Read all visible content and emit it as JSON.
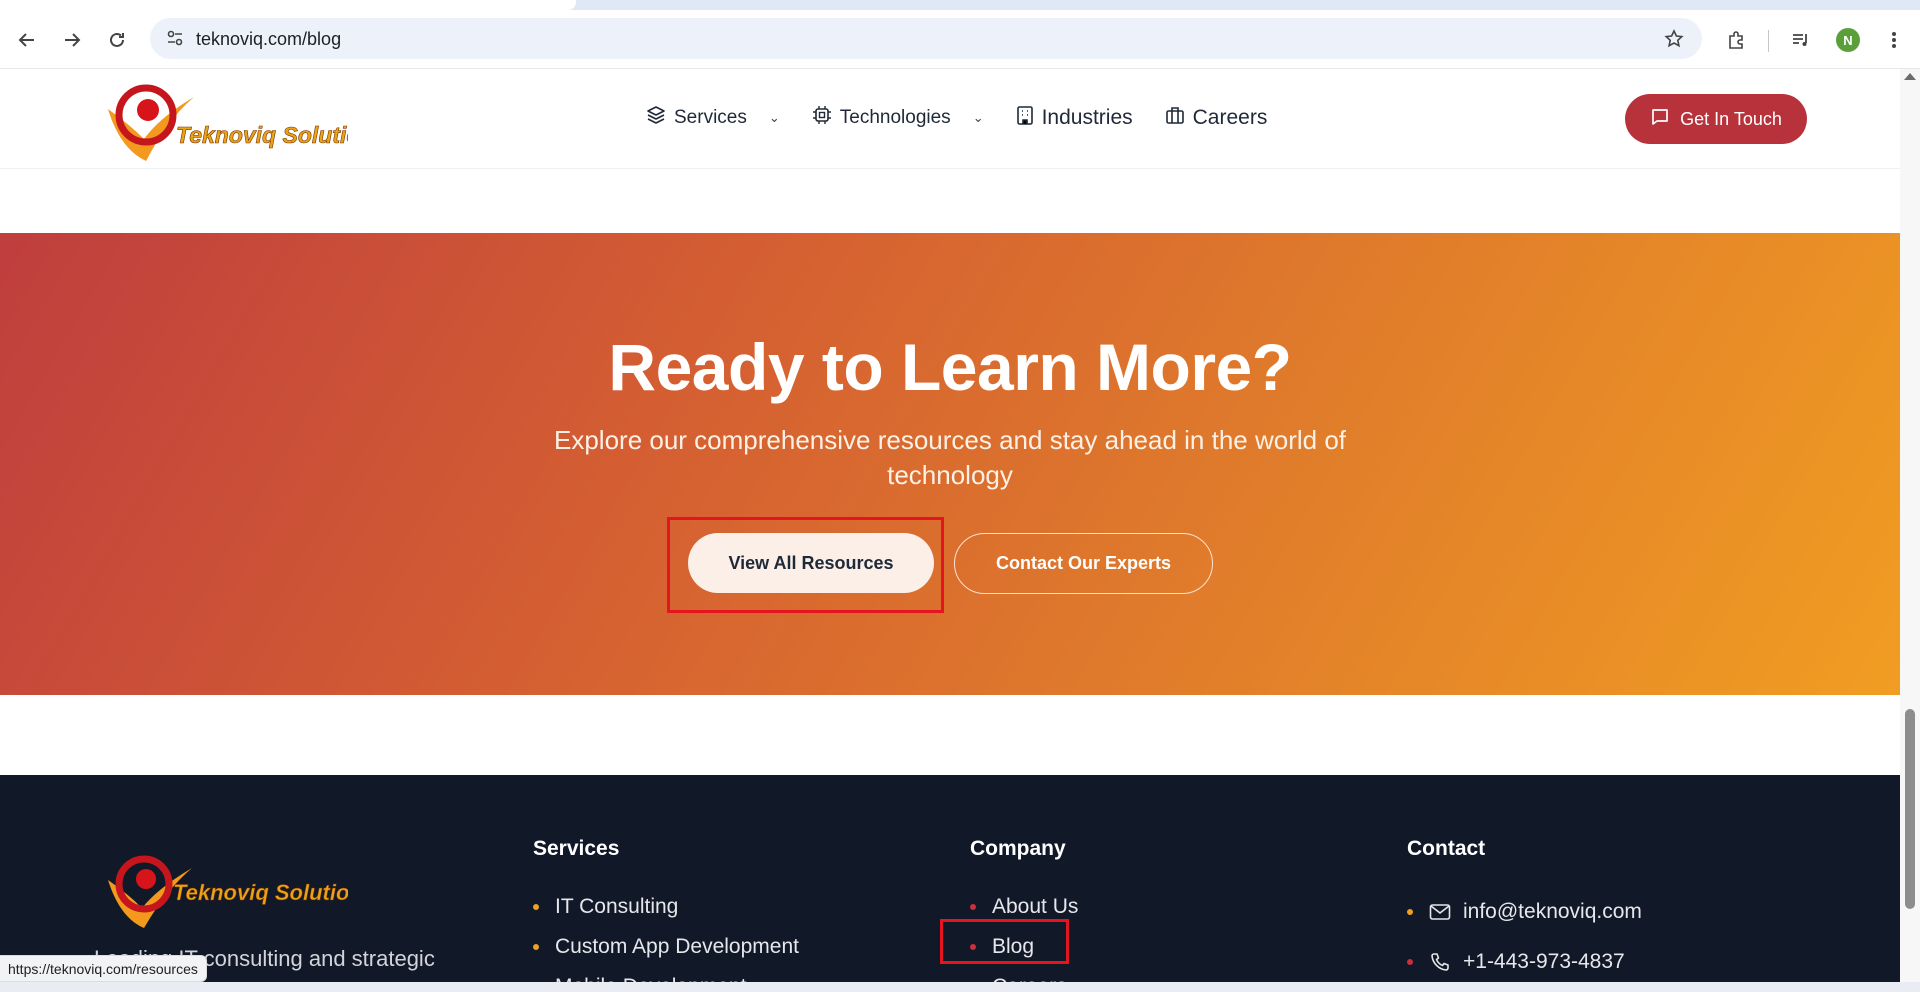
{
  "browser": {
    "url": "teknoviq.com/blog",
    "profile_initial": "N",
    "status_url": "https://teknoviq.com/resources"
  },
  "header": {
    "logo_text": "Teknoviq Solutions",
    "nav": [
      {
        "label": "Services",
        "icon": "layers-icon",
        "has_dropdown": true
      },
      {
        "label": "Technologies",
        "icon": "cpu-icon",
        "has_dropdown": true
      },
      {
        "label": "Industries",
        "icon": "building-icon",
        "has_dropdown": false
      },
      {
        "label": "Careers",
        "icon": "briefcase-icon",
        "has_dropdown": false
      }
    ],
    "cta_label": "Get In Touch"
  },
  "hero": {
    "title": "Ready to Learn More?",
    "subtitle": "Explore our comprehensive resources and stay ahead in the world of technology",
    "primary_button": "View All Resources",
    "secondary_button": "Contact Our Experts"
  },
  "footer": {
    "logo_text": "Teknoviq Solutions",
    "tagline": "Leading IT consulting and strategic",
    "columns": {
      "services": {
        "heading": "Services",
        "items": [
          "IT Consulting",
          "Custom App Development",
          "Mobile Development"
        ]
      },
      "company": {
        "heading": "Company",
        "items": [
          "About Us",
          "Blog",
          "Careers"
        ]
      },
      "contact": {
        "heading": "Contact",
        "email": "info@teknoviq.com",
        "phone": "+1-443-973-4837"
      }
    }
  },
  "colors": {
    "brand_red": "#b8323b",
    "hero_start": "#bf3e3e",
    "hero_end": "#f19d22",
    "footer_bg": "#111827",
    "highlight": "#e4151f"
  }
}
